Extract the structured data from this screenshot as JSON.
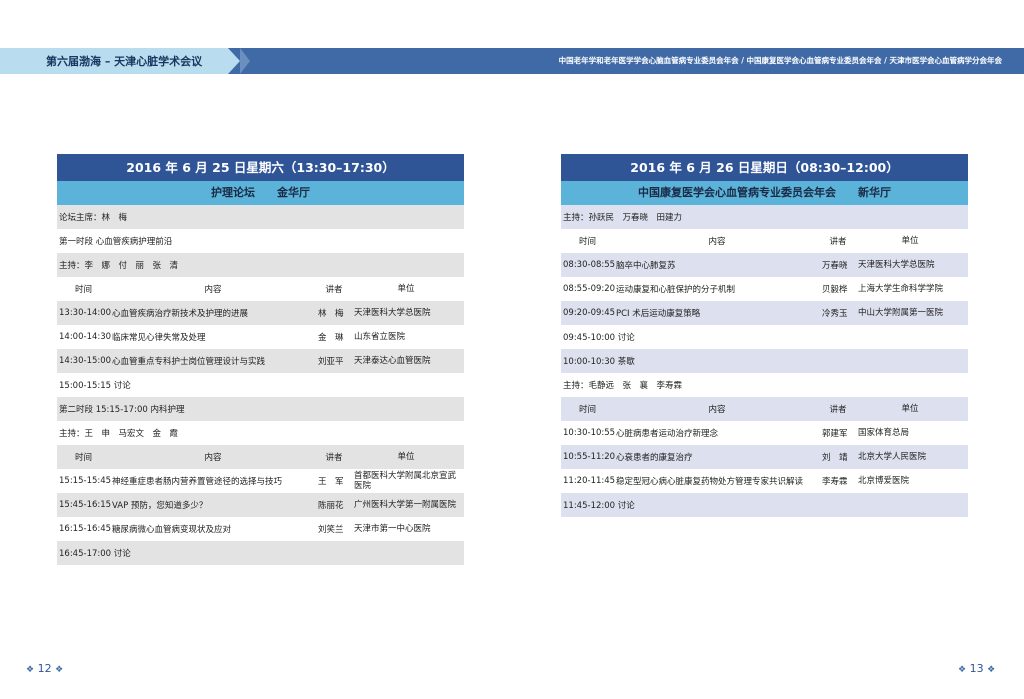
{
  "header": {
    "left_title": "第六届渤海 – 天津心脏学术会议",
    "right_text": "中国老年学和老年医学学会心脑血管病专业委员会年会 / 中国康复医学会心血管病专业委员会年会 / 天津市医学会心血管病学分会年会"
  },
  "left": {
    "title": "2016 年 6 月 25 日星期六（13:30–17:30）",
    "subtitle": "护理论坛　　金华厅",
    "chair": "论坛主席：林　梅",
    "session1": "第一时段  心血管疾病护理前沿",
    "host1": "主持：李　娜　付　丽　张　清",
    "col": {
      "time": "时间",
      "topic": "内容",
      "speaker": "讲者",
      "unit": "单位"
    },
    "rows1": [
      {
        "time": "13:30-14:00",
        "topic": "心血管疾病治疗新技术及护理的进展",
        "speaker": "林　梅",
        "unit": "天津医科大学总医院"
      },
      {
        "time": "14:00-14:30",
        "topic": "临床常见心律失常及处理",
        "speaker": "金　琳",
        "unit": "山东省立医院"
      },
      {
        "time": "14:30-15:00",
        "topic": "心血管重点专科护士岗位管理设计与实践",
        "speaker": "刘亚平",
        "unit": "天津泰达心血管医院"
      }
    ],
    "discuss1": "15:00-15:15  讨论",
    "session2": "第二时段  15:15-17:00  内科护理",
    "host2": "主持：王　申　马宏文　金　霞",
    "rows2": [
      {
        "time": "15:15-15:45",
        "topic": "神经重症患者肠内营养置管途径的选择与技巧",
        "speaker": "王　军",
        "unit": "首都医科大学附属北京宣武医院"
      },
      {
        "time": "15:45-16:15",
        "topic": "VAP 预防，您知道多少？",
        "speaker": "陈丽花",
        "unit": "广州医科大学第一附属医院"
      },
      {
        "time": "16:15-16:45",
        "topic": "糖尿病微心血管病变现状及应对",
        "speaker": "刘笑兰",
        "unit": "天津市第一中心医院"
      }
    ],
    "discuss2": "16:45-17:00  讨论"
  },
  "right": {
    "title": "2016 年 6 月 26 日星期日（08:30–12:00）",
    "subtitle": "中国康复医学会心血管病专业委员会年会　　新华厅",
    "host1": "主持：孙跃民　万春晓　田建力",
    "col": {
      "time": "时间",
      "topic": "内容",
      "speaker": "讲者",
      "unit": "单位"
    },
    "rows1": [
      {
        "time": "08:30-08:55",
        "topic": "脑卒中心肺复苏",
        "speaker": "万春晓",
        "unit": "天津医科大学总医院"
      },
      {
        "time": "08:55-09:20",
        "topic": "运动康复和心脏保护的分子机制",
        "speaker": "贝毅桦",
        "unit": "上海大学生命科学学院"
      },
      {
        "time": "09:20-09:45",
        "topic": "PCI 术后运动康复策略",
        "speaker": "冷秀玉",
        "unit": "中山大学附属第一医院"
      }
    ],
    "discuss1": "09:45-10:00  讨论",
    "break": "10:00-10:30  茶歇",
    "host2": "主持：毛静远　张　襄　李寿霖",
    "rows2": [
      {
        "time": "10:30-10:55",
        "topic": "心脏病患者运动治疗新理念",
        "speaker": "郭建军",
        "unit": "国家体育总局"
      },
      {
        "time": "10:55-11:20",
        "topic": "心衰患者的康复治疗",
        "speaker": "刘　靖",
        "unit": "北京大学人民医院"
      },
      {
        "time": "11:20-11:45",
        "topic": "稳定型冠心病心脏康复药物处方管理专家共识解读",
        "speaker": "李寿霖",
        "unit": "北京博爱医院"
      }
    ],
    "discuss2": "11:45-12:00  讨论"
  },
  "footer": {
    "left_page": "12",
    "right_page": "13",
    "diamond": "❖"
  }
}
